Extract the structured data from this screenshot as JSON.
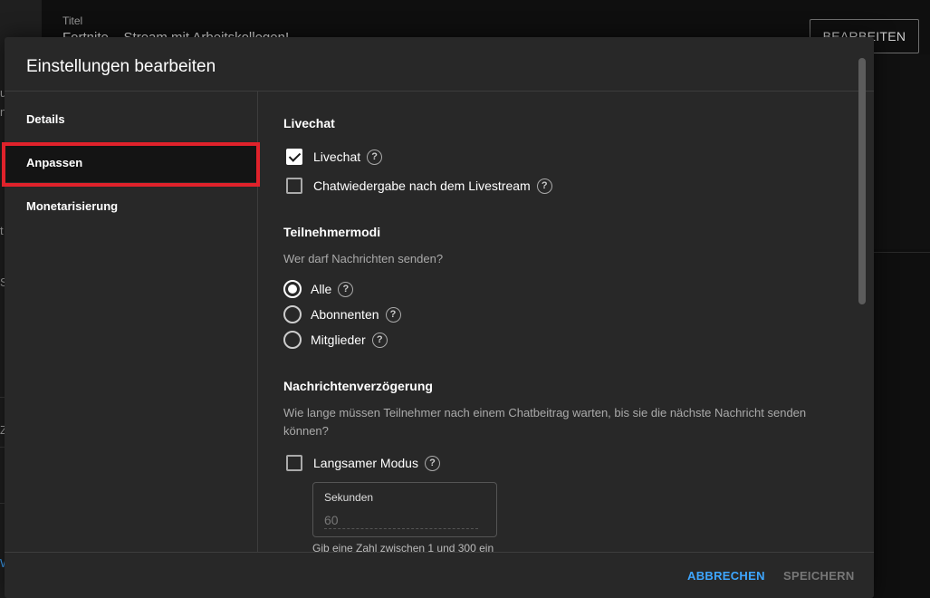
{
  "background": {
    "title_label": "Titel",
    "title_value": "Fortnite – Stream mit Arbeitskollegen!",
    "edit_button": "BEARBEITEN",
    "left_fragments": [
      "u",
      "n",
      "t",
      "S",
      "Z"
    ],
    "left_link_fragment": "W"
  },
  "modal": {
    "title": "Einstellungen bearbeiten",
    "nav": {
      "details": "Details",
      "anpassen": "Anpassen",
      "monetarisierung": "Monetarisierung"
    },
    "livechat": {
      "section_title": "Livechat",
      "livechat_label": "Livechat",
      "livechat_checked": true,
      "replay_label": "Chatwiedergabe nach dem Livestream",
      "replay_checked": false
    },
    "participant_modes": {
      "section_title": "Teilnehmermodi",
      "question": "Wer darf Nachrichten senden?",
      "options": [
        "Alle",
        "Abonnenten",
        "Mitglieder"
      ],
      "selected": "Alle"
    },
    "message_delay": {
      "section_title": "Nachrichtenverzögerung",
      "question": "Wie lange müssen Teilnehmer nach einem Chatbeitrag warten, bis sie die nächste Nachricht senden können?",
      "slow_mode_label": "Langsamer Modus",
      "slow_mode_checked": false,
      "seconds_label": "Sekunden",
      "seconds_value": "60",
      "seconds_help": "Gib eine Zahl zwischen 1 und 300 ein"
    },
    "footer": {
      "cancel": "ABBRECHEN",
      "save": "SPEICHERN"
    },
    "help_glyph": "?",
    "colors": {
      "accent": "#3ea6ff",
      "highlight": "#e0222b"
    }
  }
}
